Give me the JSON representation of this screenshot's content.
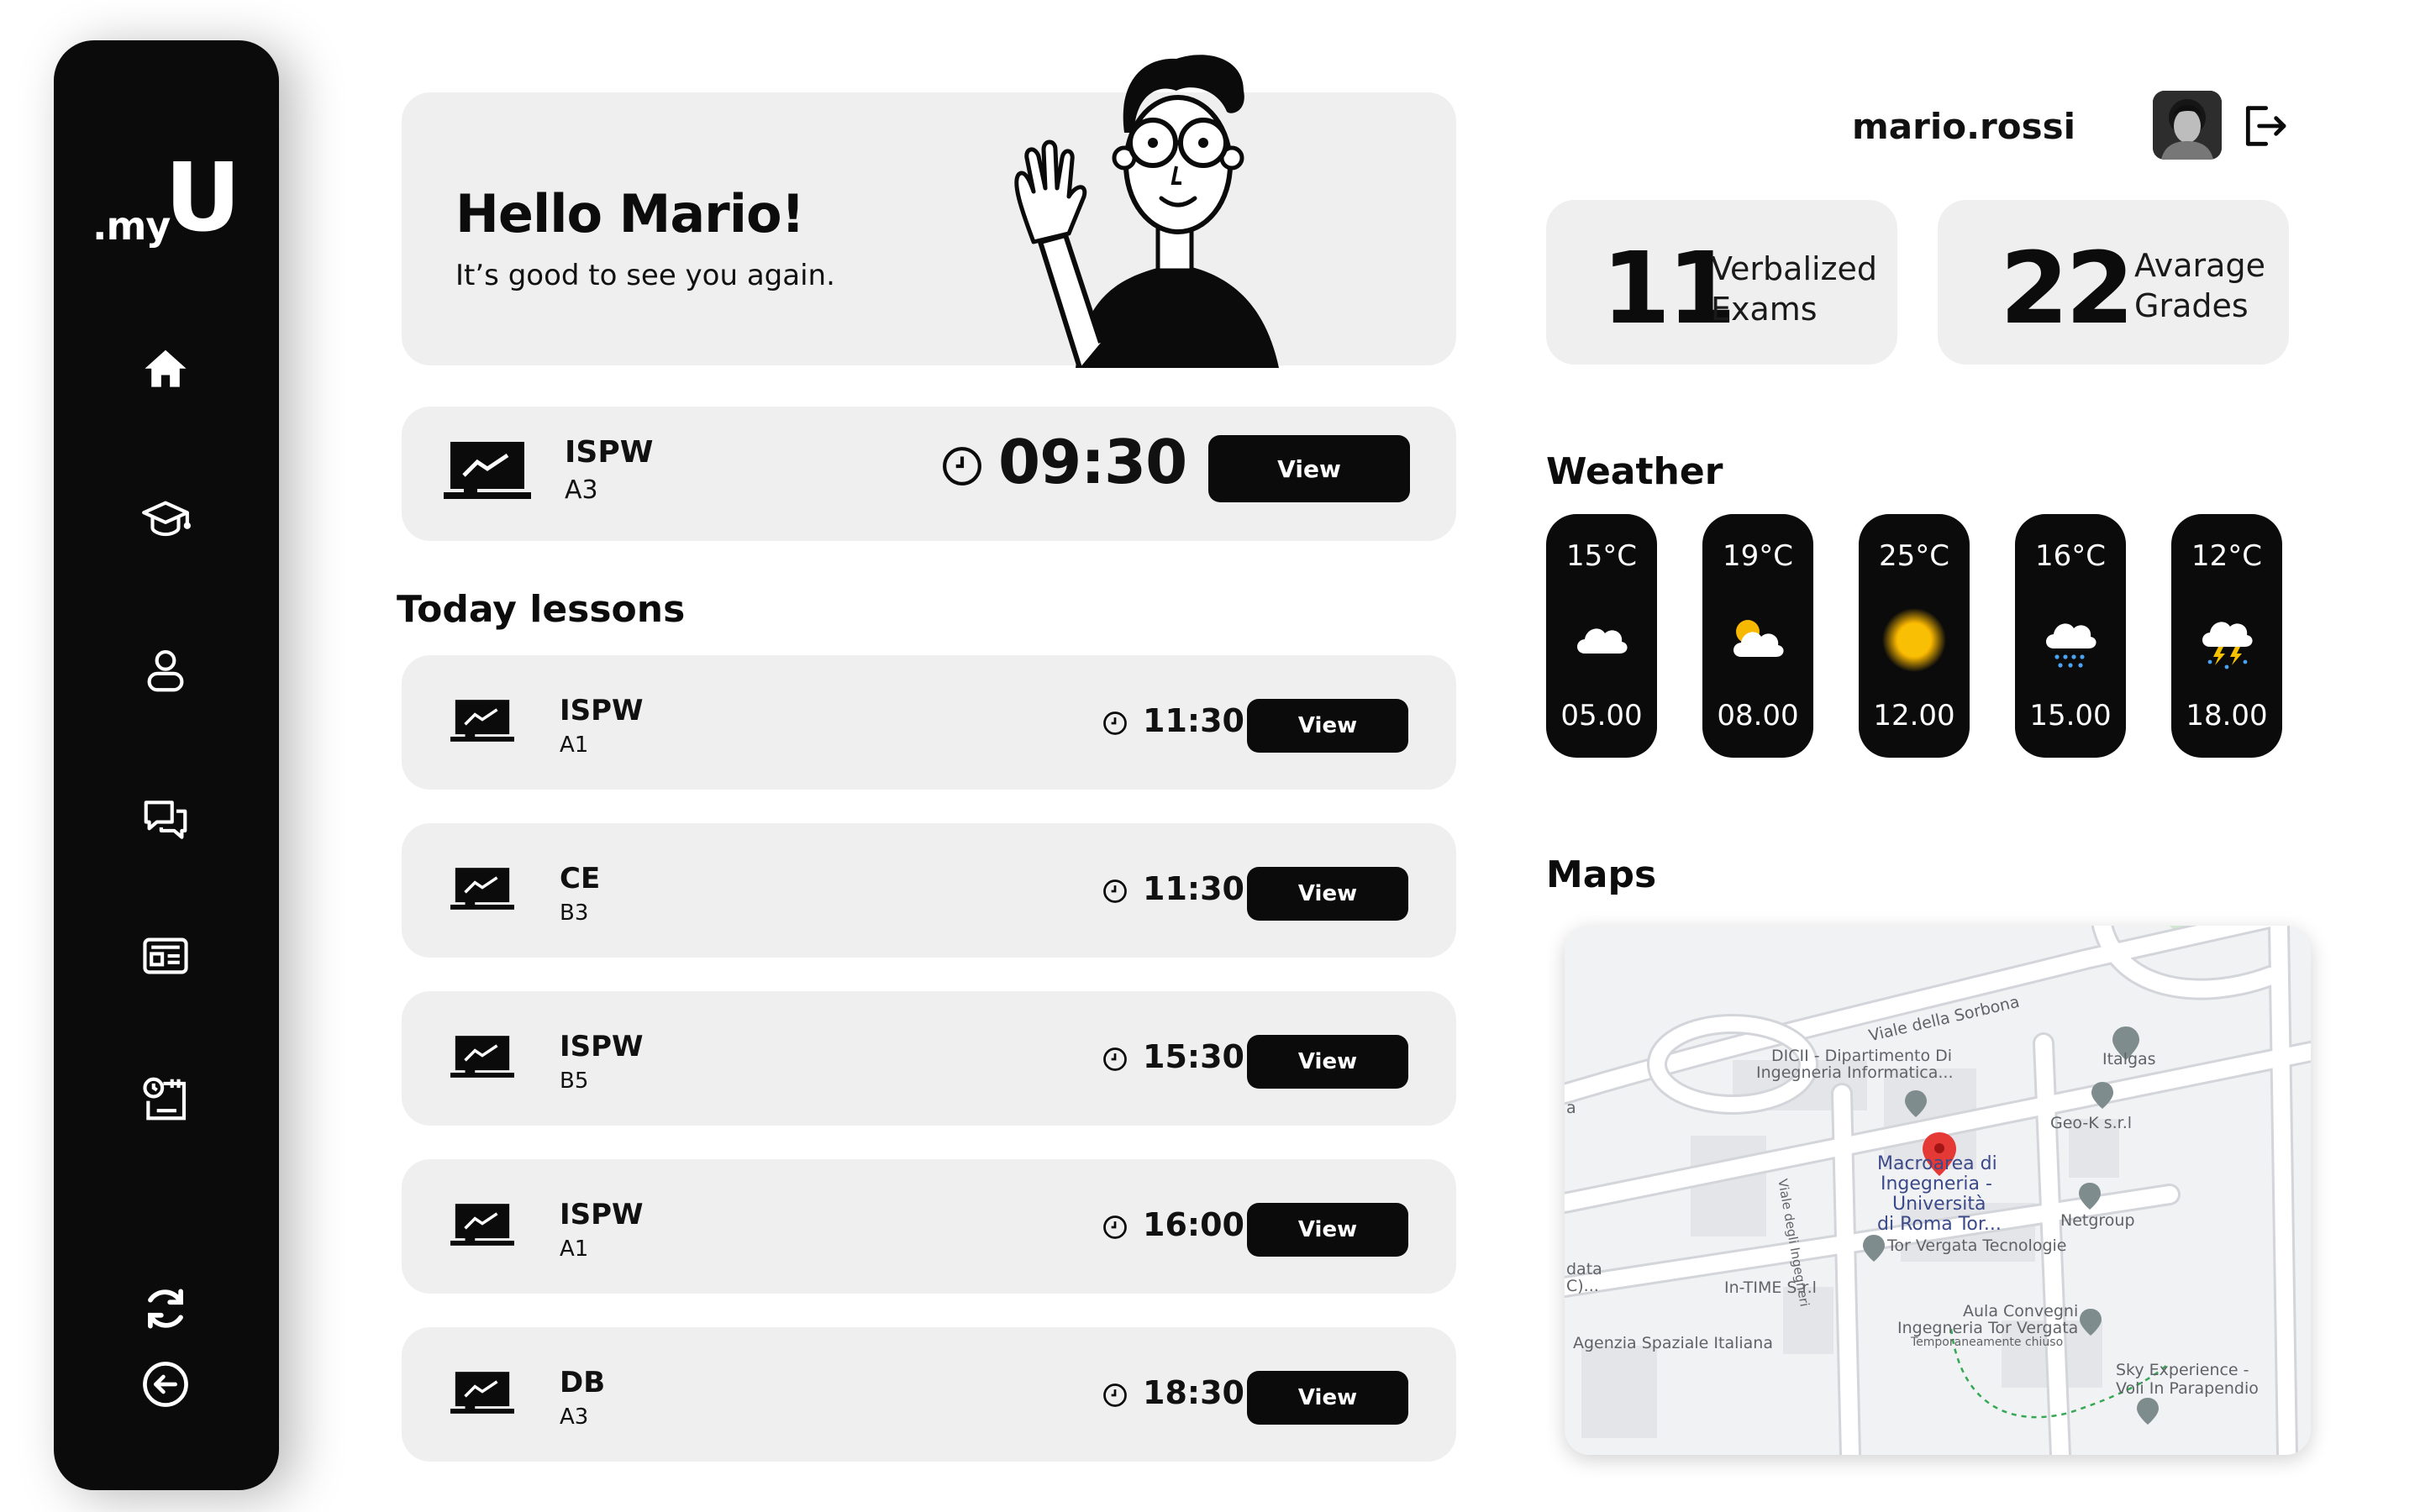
{
  "sidebar": {
    "logo_prefix": ".my",
    "logo_letter": "U",
    "items": [
      {
        "name": "home",
        "icon": "home-icon"
      },
      {
        "name": "courses",
        "icon": "graduation-cap-icon"
      },
      {
        "name": "profile",
        "icon": "user-icon"
      },
      {
        "name": "messages",
        "icon": "chat-icon"
      },
      {
        "name": "news",
        "icon": "newspaper-icon"
      },
      {
        "name": "schedule",
        "icon": "calendar-clock-icon"
      }
    ],
    "bottom": [
      {
        "name": "refresh",
        "icon": "refresh-icon"
      },
      {
        "name": "back",
        "icon": "back-arrow-icon"
      }
    ]
  },
  "welcome": {
    "title": "Hello Mario!",
    "subtitle": "It’s good to see you again."
  },
  "next_lesson": {
    "course": "ISPW",
    "room": "A3",
    "time": "09:30",
    "button": "View"
  },
  "lessons": {
    "title": "Today lessons",
    "items": [
      {
        "course": "ISPW",
        "room": "A1",
        "time": "11:30",
        "button": "View"
      },
      {
        "course": "CE",
        "room": "B3",
        "time": "11:30",
        "button": "View"
      },
      {
        "course": "ISPW",
        "room": "B5",
        "time": "15:30",
        "button": "View"
      },
      {
        "course": "ISPW",
        "room": "A1",
        "time": "16:00",
        "button": "View"
      },
      {
        "course": "DB",
        "room": "A3",
        "time": "18:30",
        "button": "View"
      }
    ]
  },
  "user": {
    "username": "mario.rossi",
    "avatar": "avatar",
    "logout_icon": "logout-icon"
  },
  "stats": [
    {
      "value": "11",
      "label_line1": "Verbalized",
      "label_line2": "Exams"
    },
    {
      "value": "22",
      "label_line1": "Avarage",
      "label_line2": "Grades"
    }
  ],
  "weather": {
    "title": "Weather",
    "items": [
      {
        "temp": "15°C",
        "time": "05.00",
        "icon": "cloud-icon"
      },
      {
        "temp": "19°C",
        "time": "08.00",
        "icon": "partly-sunny-icon"
      },
      {
        "temp": "25°C",
        "time": "12.00",
        "icon": "sun-icon"
      },
      {
        "temp": "16°C",
        "time": "15.00",
        "icon": "rain-cloud-icon"
      },
      {
        "temp": "12°C",
        "time": "18.00",
        "icon": "thunderstorm-icon"
      }
    ]
  },
  "maps": {
    "title": "Maps",
    "labels": {
      "sorbona": "Viale della Sorbona",
      "dicii_1": "DICII - Dipartimento Di",
      "dicii_2": "Ingegneria Informatica...",
      "italgas": "Italgas",
      "geok": "Geo-K s.r.l",
      "macro_1": "Macroarea di",
      "macro_2": "Ingegneria -",
      "macro_3": "Università",
      "macro_4": "di Roma Tor...",
      "netgroup": "Netgroup",
      "torvergata": "Tor Vergata Tecnologie",
      "ingegneri": "Viale degli Ingegneri",
      "intime": "In-TIME S.r.l",
      "aula_1": "Aula Convegni",
      "aula_2": "Ingegneria Tor Vergata",
      "aula_3": "Temporaneamente chiuso",
      "agenzia": "Agenzia Spaziale Italiana",
      "sky_1": "Sky Experience -",
      "sky_2": "Voli In Parapendio",
      "left_a": "a",
      "left_data": "data",
      "left_c": "C)..."
    }
  }
}
